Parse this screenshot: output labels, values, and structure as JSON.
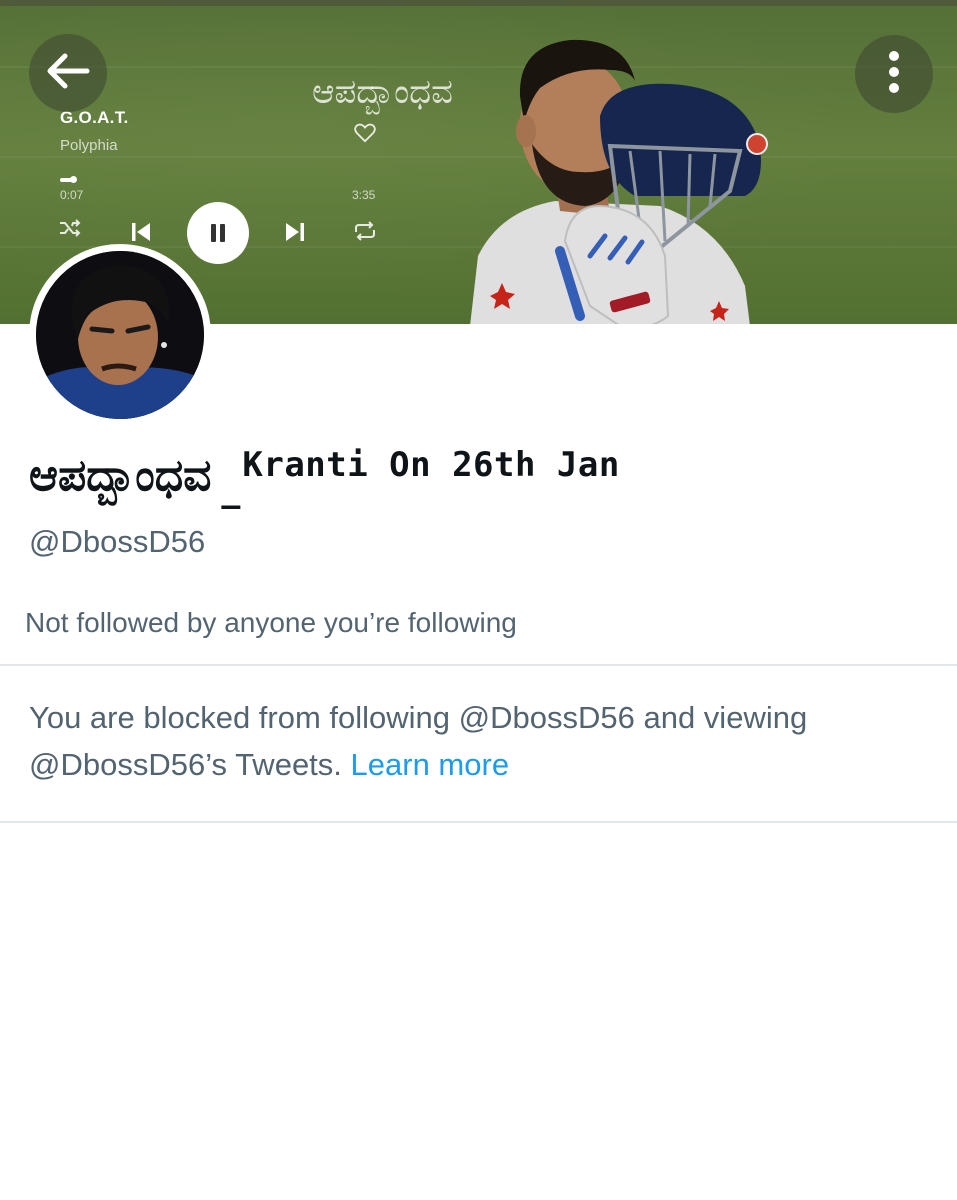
{
  "banner": {
    "now_playing": {
      "title": "G.O.A.T.",
      "artist": "Polyphia",
      "kannada_title": "ಆಪದ್ಬಾಂಧವ",
      "time_current": "0:07",
      "time_total": "3:35",
      "progress": 0.03
    }
  },
  "profile": {
    "display_name_kannada": "ಆಪದ್ಬಾಂಧವ",
    "display_name_separator": "_",
    "display_name_rest": "Kranti On 26th Jan",
    "handle": "@DbossD56",
    "followers_note": "Not followed by anyone you’re following",
    "blocked_message": "You are blocked from following @DbossD56 and viewing @DbossD56’s Tweets.",
    "learn_more": "Learn more"
  },
  "colors": {
    "text_primary": "#0f1419",
    "text_secondary": "#536471",
    "link": "#1d9bf0",
    "divider": "#e1e6ea"
  },
  "icons": [
    "back-arrow-icon",
    "more-vertical-icon",
    "heart-icon",
    "shuffle-icon",
    "previous-icon",
    "pause-icon",
    "next-icon",
    "repeat-icon"
  ]
}
